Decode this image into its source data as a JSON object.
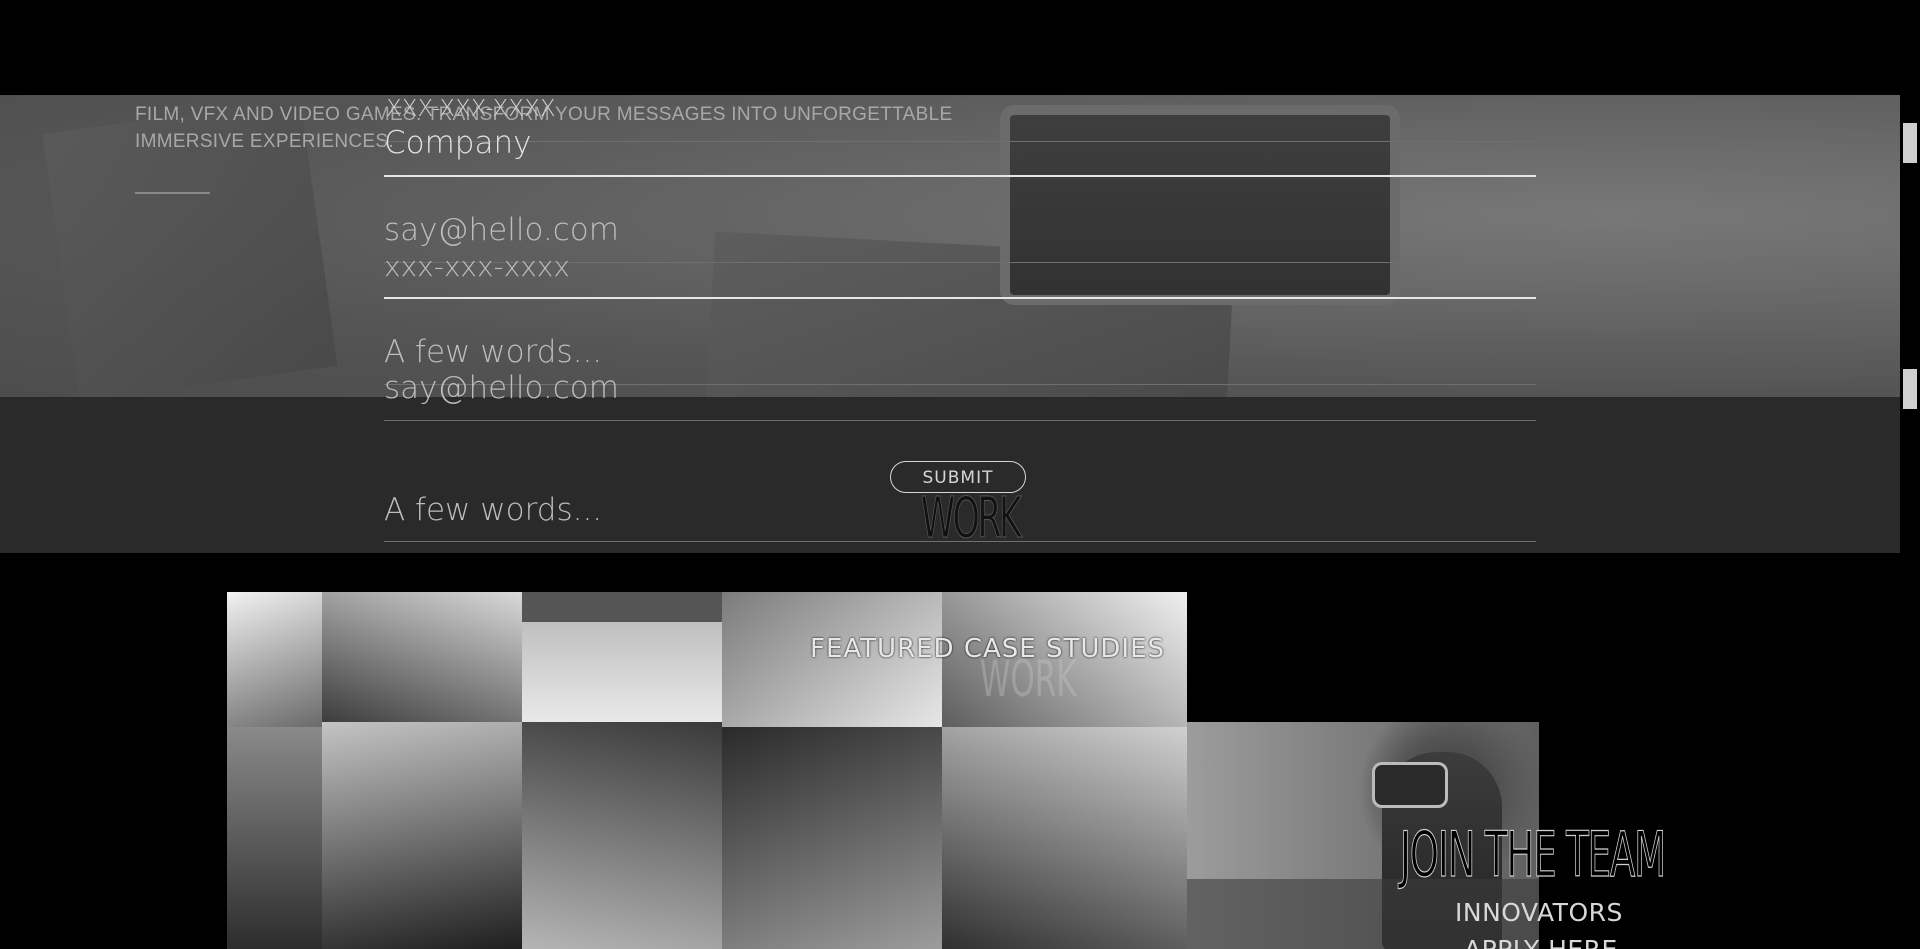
{
  "hero": {
    "text": "FILM, VFX AND VIDEO GAMES. TRANSFORM YOUR MESSAGES INTO UNFORGETTABLE IMMERSIVE EXPERIENCES."
  },
  "form": {
    "phone_ghost_top": "XXX-XXX-XXXX",
    "company_placeholder": "Company",
    "email_placeholder": "say@hello.com",
    "phone_placeholder": "xxx-xxx-xxxx",
    "message_placeholder": "A few words...",
    "email_ghost": "say@hello.com",
    "message_ghost": "A few words...",
    "submit_label": "SUBMIT"
  },
  "work": {
    "title": "WORK",
    "featured_label": "FEATURED CASE STUDIES",
    "ghost_title": "WORK"
  },
  "join": {
    "title": "JOIN THE TEAM",
    "innovators": "INNOVATORS",
    "apply": "APPLY HERE"
  }
}
